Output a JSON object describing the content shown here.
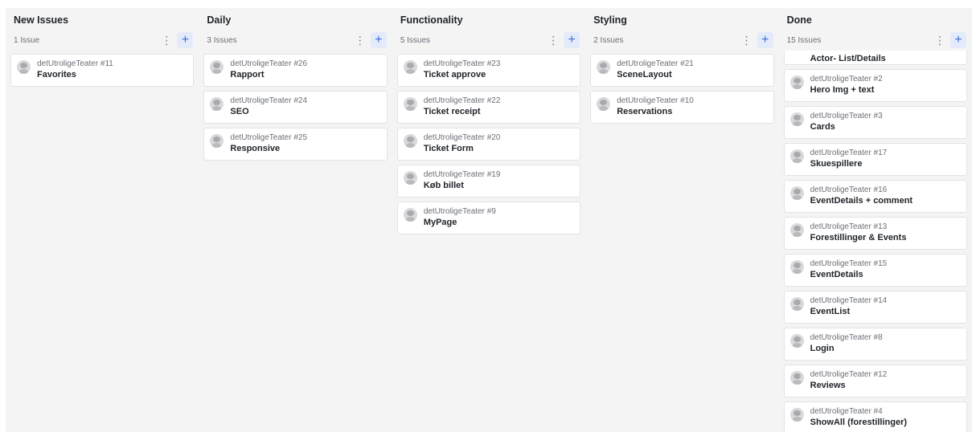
{
  "columns": [
    {
      "title": "New Issues",
      "count": "1 Issue",
      "cards": [
        {
          "repo": "detUtroligeTeater #11",
          "title": "Favorites"
        }
      ]
    },
    {
      "title": "Daily",
      "count": "3 Issues",
      "cards": [
        {
          "repo": "detUtroligeTeater #26",
          "title": "Rapport"
        },
        {
          "repo": "detUtroligeTeater #24",
          "title": "SEO"
        },
        {
          "repo": "detUtroligeTeater #25",
          "title": "Responsive"
        }
      ]
    },
    {
      "title": "Functionality",
      "count": "5 Issues",
      "cards": [
        {
          "repo": "detUtroligeTeater #23",
          "title": "Ticket approve"
        },
        {
          "repo": "detUtroligeTeater #22",
          "title": "Ticket receipt"
        },
        {
          "repo": "detUtroligeTeater #20",
          "title": "Ticket Form"
        },
        {
          "repo": "detUtroligeTeater #19",
          "title": "Køb billet"
        },
        {
          "repo": "detUtroligeTeater #9",
          "title": "MyPage"
        }
      ]
    },
    {
      "title": "Styling",
      "count": "2 Issues",
      "cards": [
        {
          "repo": "detUtroligeTeater #21",
          "title": "SceneLayout"
        },
        {
          "repo": "detUtroligeTeater #10",
          "title": "Reservations"
        }
      ]
    },
    {
      "title": "Done",
      "count": "15 Issues",
      "partial_card_title": "Actor- List/Details",
      "cards": [
        {
          "repo": "detUtroligeTeater #2",
          "title": "Hero Img + text"
        },
        {
          "repo": "detUtroligeTeater #3",
          "title": "Cards"
        },
        {
          "repo": "detUtroligeTeater #17",
          "title": "Skuespillere"
        },
        {
          "repo": "detUtroligeTeater #16",
          "title": "EventDetails + comment"
        },
        {
          "repo": "detUtroligeTeater #13",
          "title": "Forestillinger & Events"
        },
        {
          "repo": "detUtroligeTeater #15",
          "title": "EventDetails"
        },
        {
          "repo": "detUtroligeTeater #14",
          "title": "EventList"
        },
        {
          "repo": "detUtroligeTeater #8",
          "title": "Login"
        },
        {
          "repo": "detUtroligeTeater #12",
          "title": "Reviews"
        },
        {
          "repo": "detUtroligeTeater #4",
          "title": "ShowAll (forestillinger)"
        }
      ]
    }
  ],
  "icons": {
    "kebab": "⋮",
    "add": "+"
  }
}
